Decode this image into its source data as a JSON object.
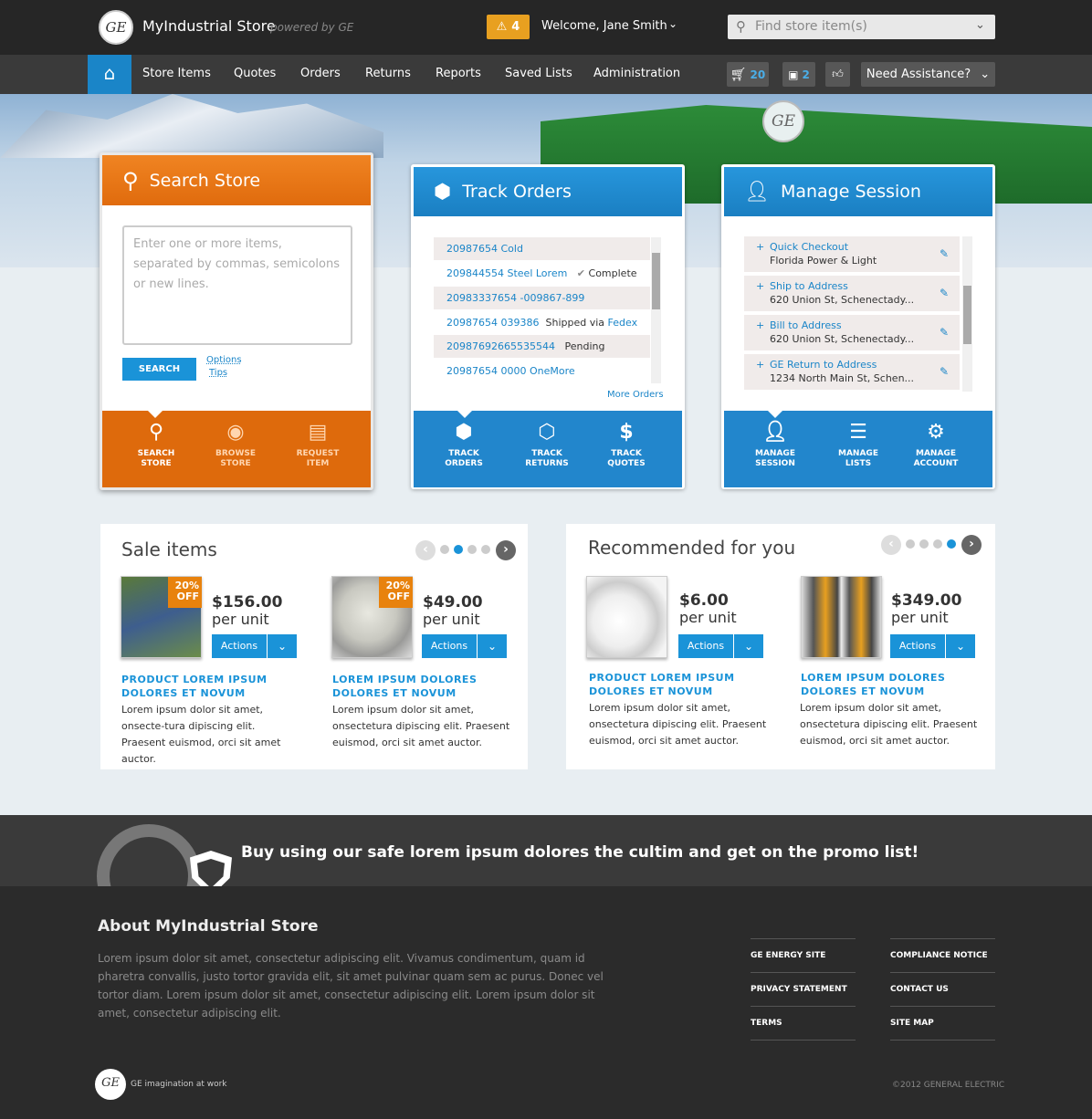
{
  "header": {
    "logo_text": "GE",
    "app_title": "MyIndustrial Store",
    "powered_by": "powered by GE",
    "alert_count": "4",
    "welcome": "Welcome, Jane Smith",
    "search_placeholder": "Find store item(s)"
  },
  "nav": {
    "items": [
      "Store Items",
      "Quotes",
      "Orders",
      "Returns",
      "Reports",
      "Saved Lists",
      "Administration"
    ],
    "cart_count": "20",
    "box_count": "2",
    "assist_label": "Need Assistance?"
  },
  "search_panel": {
    "title": "Search Store",
    "textarea_placeholder": "Enter one or more items, separated by commas, semicolons or new lines.",
    "search_button": "SEARCH",
    "options_link": "Options",
    "tips_link": "Tips",
    "footer_items": [
      {
        "label_1": "SEARCH",
        "label_2": "STORE",
        "icon": "search-icon"
      },
      {
        "label_1": "BROWSE",
        "label_2": "STORE",
        "icon": "eye-icon"
      },
      {
        "label_1": "REQUEST",
        "label_2": "ITEM",
        "icon": "document-icon"
      }
    ]
  },
  "track_panel": {
    "title": "Track Orders",
    "orders": [
      {
        "id": "20987654 Cold",
        "status": "",
        "carrier": ""
      },
      {
        "id": "209844554 Steel Lorem",
        "status": "Complete",
        "carrier": ""
      },
      {
        "id": "20983337654 -009867-899",
        "status": "",
        "carrier": ""
      },
      {
        "id": "20987654 039386",
        "status": "Shipped via",
        "carrier": "Fedex"
      },
      {
        "id": "20987692665535544",
        "status": "Pending",
        "carrier": ""
      },
      {
        "id": "20987654 0000 OneMore",
        "status": "",
        "carrier": ""
      }
    ],
    "more_link": "More Orders",
    "footer_items": [
      {
        "label_1": "TRACK",
        "label_2": "ORDERS",
        "icon": "box-icon"
      },
      {
        "label_1": "TRACK",
        "label_2": "RETURNS",
        "icon": "return-box-icon"
      },
      {
        "label_1": "TRACK",
        "label_2": "QUOTES",
        "icon": "dollar-icon"
      }
    ]
  },
  "manage_panel": {
    "title": "Manage Session",
    "rows": [
      {
        "label": "Quick Checkout",
        "value": "Florida Power & Light"
      },
      {
        "label": "Ship to Address",
        "value": "620 Union St, Schenectady..."
      },
      {
        "label": "Bill to Address",
        "value": "620 Union St, Schenectady..."
      },
      {
        "label": "GE Return to Address",
        "value": "1234 North Main St, Schen..."
      }
    ],
    "footer_items": [
      {
        "label_1": "MANAGE",
        "label_2": "SESSION",
        "icon": "user-icon"
      },
      {
        "label_1": "MANAGE",
        "label_2": "LISTS",
        "icon": "list-icon"
      },
      {
        "label_1": "MANAGE",
        "label_2": "ACCOUNT",
        "icon": "gears-icon"
      }
    ]
  },
  "sale": {
    "title": "Sale items",
    "products": [
      {
        "price": "$156.00",
        "unit": "per unit",
        "badge_1": "20%",
        "badge_2": "OFF",
        "actions": "Actions",
        "name": "PRODUCT LOREM IPSUM DOLORES ET NOVUM",
        "desc": "Lorem ipsum dolor sit amet, onsecte-tura dipiscing elit. Praesent euismod, orci sit amet auctor."
      },
      {
        "price": "$49.00",
        "unit": "per unit",
        "badge_1": "20%",
        "badge_2": "OFF",
        "actions": "Actions",
        "name": "LOREM IPSUM DOLORES DOLORES ET NOVUM",
        "desc": "Lorem ipsum dolor sit amet, onsectetura dipiscing elit. Praesent euismod, orci sit amet auctor."
      }
    ]
  },
  "recommended": {
    "title": "Recommended for you",
    "products": [
      {
        "price": "$6.00",
        "unit": "per unit",
        "actions": "Actions",
        "name": "PRODUCT LOREM IPSUM DOLORES ET NOVUM",
        "desc": "Lorem ipsum dolor sit amet, onsectetura dipiscing elit. Praesent euismod, orci sit amet auctor."
      },
      {
        "price": "$349.00",
        "unit": "per unit",
        "actions": "Actions",
        "name": "LOREM IPSUM DOLORES DOLORES ET NOVUM",
        "desc": "Lorem ipsum dolor sit amet, onsectetura dipiscing elit. Praesent euismod, orci sit amet auctor."
      }
    ]
  },
  "promo": {
    "text": "Buy using our safe lorem ipsum dolores the cultim and get on the promo list!"
  },
  "footer": {
    "about_title": "About MyIndustrial Store",
    "about_text": "Lorem ipsum dolor sit amet, consectetur adipiscing elit. Vivamus condimentum, quam id pharetra convallis, justo tortor gravida elit, sit amet pulvinar quam sem ac purus. Donec vel tortor diam. Lorem ipsum dolor sit amet, consectetur adipiscing elit. Lorem ipsum dolor sit amet, consectetur adipiscing elit.",
    "links_col1": [
      "GE ENERGY SITE",
      "PRIVACY STATEMENT",
      "TERMS"
    ],
    "links_col2": [
      "COMPLIANCE NOTICE",
      "CONTACT US",
      "SITE MAP"
    ],
    "logo_text": "GE",
    "tagline": "GE imagination at work",
    "copyright": "©2012 GENERAL ELECTRIC"
  },
  "colors": {
    "accent_blue": "#1a93d8",
    "accent_orange": "#e06b0d",
    "dark": "#2b2b2b"
  }
}
